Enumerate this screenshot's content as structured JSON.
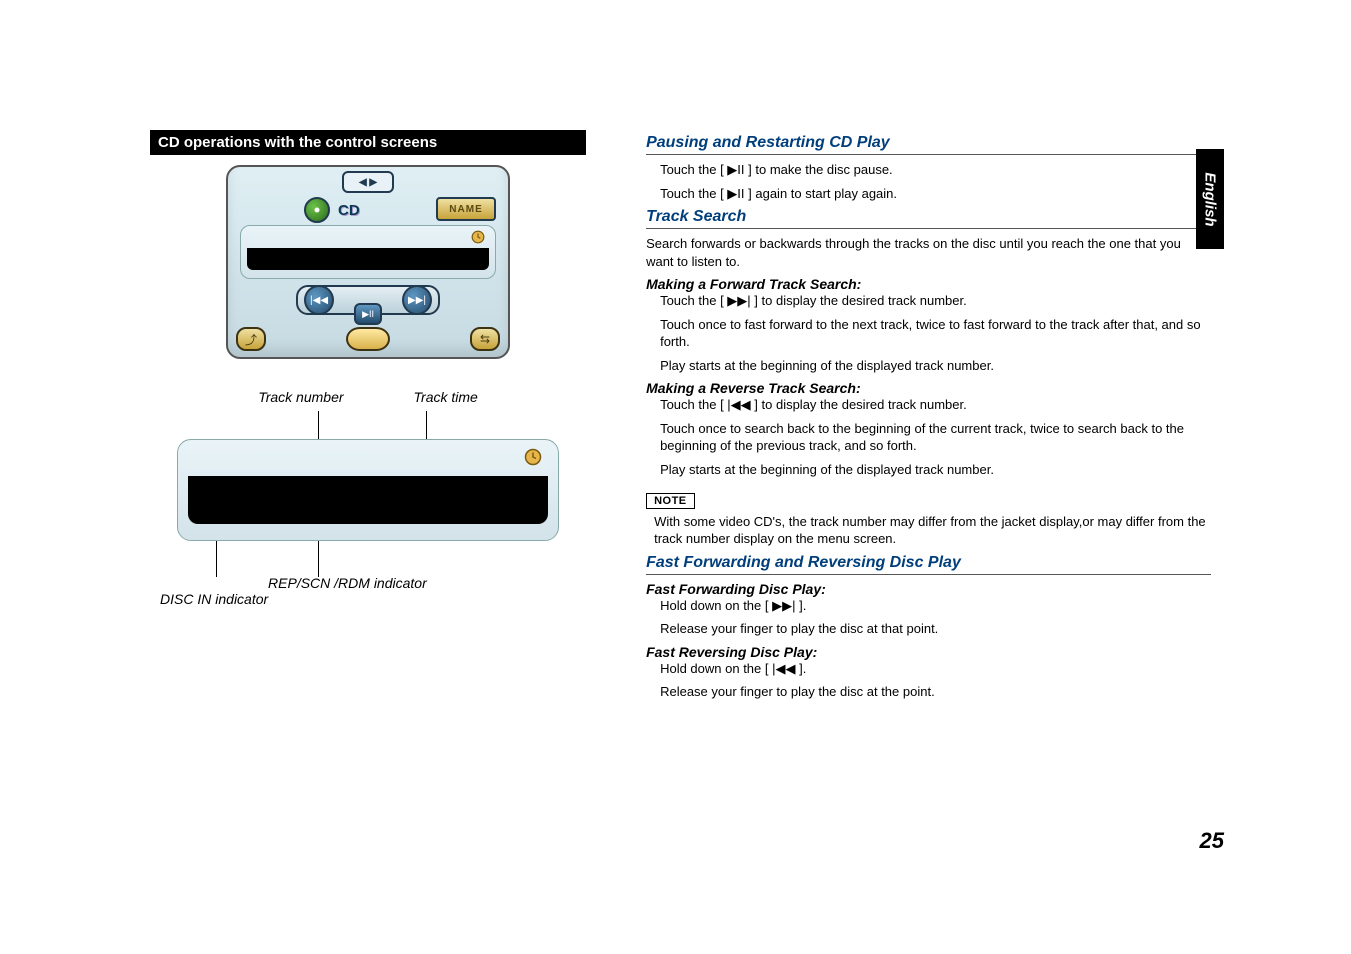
{
  "language_tab": "English",
  "page_number": "25",
  "left": {
    "section_title": "CD operations with the control screens",
    "device_mode": "CD",
    "name_button": "NAME",
    "callout_track_number": "Track number",
    "callout_track_time": "Track time",
    "callout_rep_scn_rdm": "REP/SCN /RDM indicator",
    "callout_disc_in": "DISC IN indicator"
  },
  "right": {
    "h1": "Pausing and Restarting CD Play",
    "h1_line1_a": "Touch the [ ",
    "h1_line1_b": " ] to make the disc pause.",
    "h1_line2_a": "Touch the [ ",
    "h1_line2_b": " ] again to start play again.",
    "play_pause_glyph": "▶II",
    "h2": "Track Search",
    "h2_lead": "Search forwards or backwards through the tracks on the disc until you reach the one that you want to listen to.",
    "fwd_head": "Making a Forward Track Search:",
    "fwd_l1_a": "Touch the [ ",
    "fwd_l1_b": " ] to display the desired track number.",
    "next_glyph": "▶▶|",
    "fwd_l2": "Touch once to fast forward to the next track, twice to fast forward to the track after that, and so forth.",
    "fwd_l3": "Play starts at the beginning of the displayed track number.",
    "rev_head": "Making a Reverse Track Search:",
    "rev_l1_a": "Touch the [ ",
    "rev_l1_b": " ] to display the desired track number.",
    "prev_glyph": "|◀◀",
    "rev_l2": "Touch once to search back to the beginning of the current track, twice to search back to the beginning of the previous track, and so forth.",
    "rev_l3": "Play starts at the beginning of the displayed track number.",
    "note_label": "NOTE",
    "note_body": "With some video CD's, the track number may differ from the jacket display,or may differ from the track number display on the menu screen.",
    "h3": "Fast Forwarding and Reversing Disc Play",
    "ff_head": "Fast Forwarding Disc Play:",
    "ff_l1_a": "Hold down on the [ ",
    "ff_l1_b": " ].",
    "ff_l2": "Release your finger to play the disc at that point.",
    "fr_head": "Fast Reversing Disc Play:",
    "fr_l1_a": "Hold down on the [ ",
    "fr_l1_b": " ].",
    "fr_l2": "Release your finger to play the disc at the point."
  }
}
